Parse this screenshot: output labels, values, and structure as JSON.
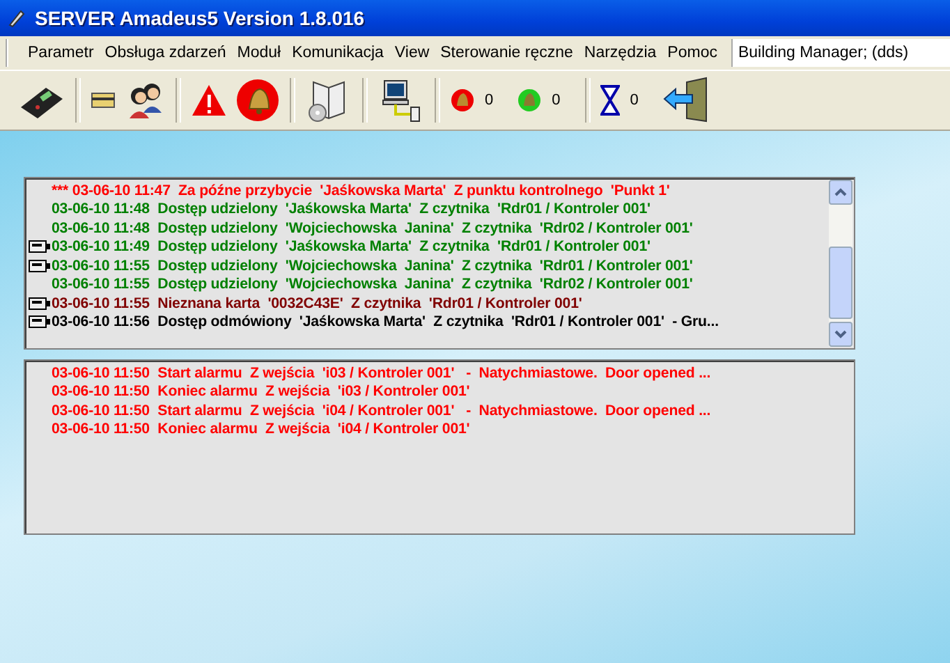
{
  "window": {
    "title": "SERVER Amadeus5 Version 1.8.016"
  },
  "menu": [
    "Parametr",
    "Obsługa zdarzeń",
    "Moduł",
    "Komunikacja",
    "View",
    "Sterowanie ręczne",
    "Narzędzia",
    "Pomoc"
  ],
  "user_field": {
    "value": "Building Manager; (dds)"
  },
  "toolbar": {
    "alarm_count": "0",
    "ack_count": "0",
    "pending_count": "0"
  },
  "event_log": [
    {
      "text": "*** 03-06-10 11:47  Za późne przybycie  'Jaśkowska Marta'  Z punktu kontrolnego  'Punkt 1'",
      "color": "#ff0000",
      "card_icon": false
    },
    {
      "text": "03-06-10 11:48  Dostęp udzielony  'Jaśkowska Marta'  Z czytnika  'Rdr01 / Kontroler 001'",
      "color": "#008000",
      "card_icon": false
    },
    {
      "text": "03-06-10 11:48  Dostęp udzielony  'Wojciechowska  Janina'  Z czytnika  'Rdr02 / Kontroler 001'",
      "color": "#008000",
      "card_icon": false
    },
    {
      "text": "03-06-10 11:49  Dostęp udzielony  'Jaśkowska Marta'  Z czytnika  'Rdr01 / Kontroler 001'",
      "color": "#008000",
      "card_icon": true
    },
    {
      "text": "03-06-10 11:55  Dostęp udzielony  'Wojciechowska  Janina'  Z czytnika  'Rdr01 / Kontroler 001'",
      "color": "#008000",
      "card_icon": true
    },
    {
      "text": "03-06-10 11:55  Dostęp udzielony  'Wojciechowska  Janina'  Z czytnika  'Rdr02 / Kontroler 001'",
      "color": "#008000",
      "card_icon": false
    },
    {
      "text": "03-06-10 11:55  Nieznana karta  '0032C43E'  Z czytnika  'Rdr01 / Kontroler 001'",
      "color": "#800000",
      "card_icon": true
    },
    {
      "text": "03-06-10 11:56  Dostęp odmówiony  'Jaśkowska Marta'  Z czytnika  'Rdr01 / Kontroler 001'  - Gru...",
      "color": "#000000",
      "card_icon": true
    }
  ],
  "alarm_log": [
    {
      "text": "03-06-10 11:50  Start alarmu  Z wejścia  'i03 / Kontroler 001'   -  Natychmiastowe.  Door opened ...",
      "color": "#ff0000"
    },
    {
      "text": "03-06-10 11:50  Koniec alarmu  Z wejścia  'i03 / Kontroler 001'",
      "color": "#ff0000"
    },
    {
      "text": "03-06-10 11:50  Start alarmu  Z wejścia  'i04 / Kontroler 001'   -  Natychmiastowe.  Door opened ...",
      "color": "#ff0000"
    },
    {
      "text": "03-06-10 11:50  Koniec alarmu  Z wejścia  'i04 / Kontroler 001'",
      "color": "#ff0000"
    }
  ]
}
